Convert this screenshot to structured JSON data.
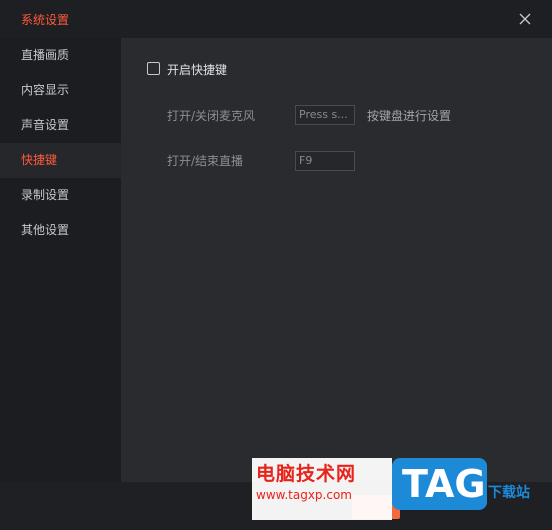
{
  "window": {
    "title": "系统设置",
    "close_icon": "close-icon"
  },
  "sidebar": {
    "items": [
      {
        "label": "直播画质",
        "active": false
      },
      {
        "label": "内容显示",
        "active": false
      },
      {
        "label": "声音设置",
        "active": false
      },
      {
        "label": "快捷键",
        "active": true
      },
      {
        "label": "录制设置",
        "active": false
      },
      {
        "label": "其他设置",
        "active": false
      }
    ]
  },
  "hotkeys": {
    "enable_label": "开启快捷键",
    "enabled": false,
    "rows": [
      {
        "label": "打开/关闭麦克风",
        "value": "Press s..."
      },
      {
        "label": "打开/结束直播",
        "value": "F9"
      }
    ],
    "hint": "按键盘进行设置"
  },
  "watermark": {
    "title": "电脑技术网",
    "url": "www.tagxp.com",
    "badge": "TAG",
    "side_text": "下载站"
  },
  "colors": {
    "accent": "#ff5a3c",
    "background": "#2a2b2f",
    "sidebar": "#1c1d20"
  }
}
